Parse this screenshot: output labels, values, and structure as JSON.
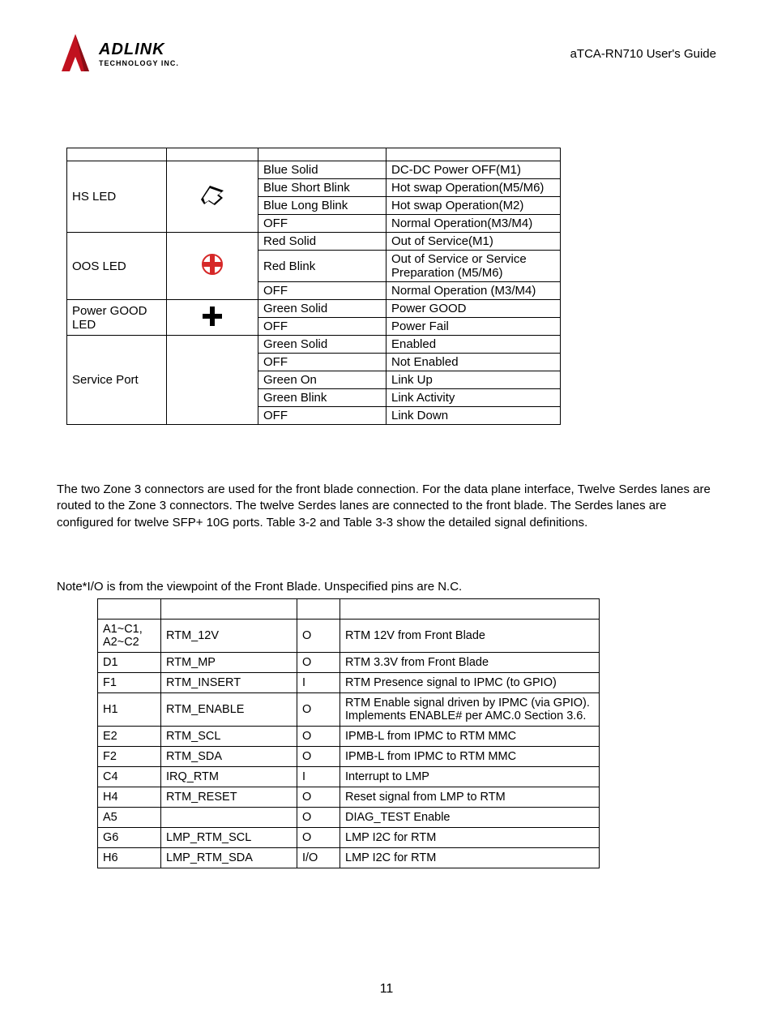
{
  "header": {
    "brand_top": "ADLINK",
    "brand_bottom": "TECHNOLOGY INC.",
    "guide": "aTCA-RN710 User's Guide"
  },
  "led_table": [
    {
      "led": "HS LED",
      "rows": [
        {
          "color": "Blue Solid",
          "desc": "DC-DC Power OFF(M1)"
        },
        {
          "color": "Blue Short Blink",
          "desc": "Hot swap Operation(M5/M6)"
        },
        {
          "color": "Blue Long Blink",
          "desc": "Hot swap Operation(M2)"
        },
        {
          "color": "OFF",
          "desc": "Normal Operation(M3/M4)"
        }
      ]
    },
    {
      "led": "OOS LED",
      "rows": [
        {
          "color": "Red Solid",
          "desc": "Out of Service(M1)"
        },
        {
          "color": "Red Blink",
          "desc": "Out of Service or Service Preparation (M5/M6)"
        },
        {
          "color": "OFF",
          "desc": "Normal Operation (M3/M4)"
        }
      ]
    },
    {
      "led": "Power GOOD LED",
      "rows": [
        {
          "color": "Green Solid",
          "desc": "Power GOOD"
        },
        {
          "color": "OFF",
          "desc": "Power Fail"
        }
      ]
    },
    {
      "led": "Service Port",
      "rows": [
        {
          "color": "Green Solid",
          "desc": "Enabled"
        },
        {
          "color": "OFF",
          "desc": "Not Enabled"
        },
        {
          "color": "Green On",
          "desc": "Link Up"
        },
        {
          "color": "Green Blink",
          "desc": "Link Activity"
        },
        {
          "color": "OFF",
          "desc": "Link Down"
        }
      ]
    }
  ],
  "paragraph": "The two Zone 3 connectors are used for the front blade connection. For the data plane interface, Twelve Serdes lanes are routed to the Zone 3 connectors. The twelve Serdes lanes are connected to the front blade. The Serdes lanes are configured for twelve SFP+ 10G ports. Table 3-2 and Table 3-3 show the detailed signal definitions.",
  "note": "Note*I/O is from the viewpoint of the Front Blade. Unspecified pins are N.C.",
  "pin_table": [
    {
      "pin": "A1~C1, A2~C2",
      "signal": "RTM_12V",
      "io": "O",
      "desc": "RTM 12V from Front Blade"
    },
    {
      "pin": "D1",
      "signal": "RTM_MP",
      "io": "O",
      "desc": "RTM 3.3V from Front Blade"
    },
    {
      "pin": "F1",
      "signal": "RTM_INSERT",
      "io": "I",
      "desc": "RTM Presence signal to IPMC (to GPIO)"
    },
    {
      "pin": "H1",
      "signal": "RTM_ENABLE",
      "io": "O",
      "desc": "RTM Enable signal driven by IPMC (via GPIO).  Implements ENABLE# per AMC.0 Section 3.6."
    },
    {
      "pin": "E2",
      "signal": "RTM_SCL",
      "io": "O",
      "desc": "IPMB-L from IPMC to RTM MMC"
    },
    {
      "pin": "F2",
      "signal": "RTM_SDA",
      "io": "O",
      "desc": "IPMB-L from IPMC to RTM MMC"
    },
    {
      "pin": "C4",
      "signal": "IRQ_RTM",
      "io": "I",
      "desc": "Interrupt to LMP"
    },
    {
      "pin": "H4",
      "signal": "RTM_RESET",
      "io": "O",
      "desc": "Reset signal from LMP to RTM"
    },
    {
      "pin": "A5",
      "signal": "",
      "io": "O",
      "desc": "DIAG_TEST Enable"
    },
    {
      "pin": "G6",
      "signal": "LMP_RTM_SCL",
      "io": "O",
      "desc": "LMP I2C for RTM"
    },
    {
      "pin": "H6",
      "signal": "LMP_RTM_SDA",
      "io": "I/O",
      "desc": "LMP I2C for RTM"
    }
  ],
  "page_number": "11"
}
